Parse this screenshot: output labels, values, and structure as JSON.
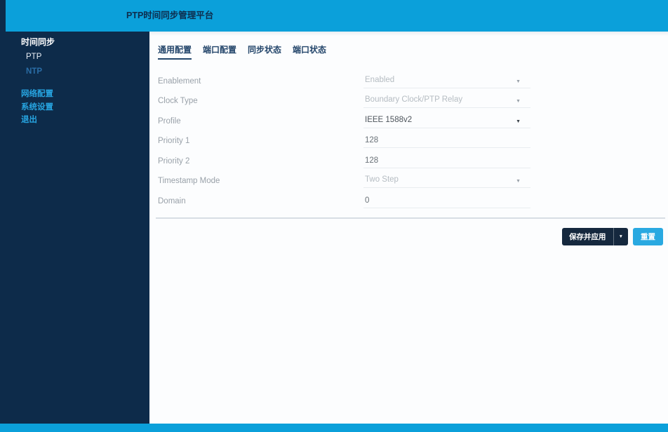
{
  "header": {
    "title": "PTP时间同步管理平台"
  },
  "sidebar": {
    "items": [
      {
        "label": "时间同步"
      },
      {
        "label": "PTP"
      },
      {
        "label": "NTP"
      },
      {
        "label": "网络配置"
      },
      {
        "label": "系统设置"
      },
      {
        "label": "退出"
      }
    ]
  },
  "main": {
    "tabs": [
      {
        "label": "通用配置",
        "active": true
      },
      {
        "label": "端口配置",
        "active": false
      },
      {
        "label": "同步状态",
        "active": false
      },
      {
        "label": "端口状态",
        "active": false
      }
    ],
    "form": {
      "fields": [
        {
          "label": "Enablement",
          "value": "Enabled",
          "type": "select",
          "disabled": true
        },
        {
          "label": "Clock Type",
          "value": "Boundary Clock/PTP Relay",
          "type": "select",
          "disabled": true
        },
        {
          "label": "Profile",
          "value": "IEEE 1588v2",
          "type": "select",
          "disabled": false
        },
        {
          "label": "Priority 1",
          "value": "128",
          "type": "input",
          "disabled": false
        },
        {
          "label": "Priority 2",
          "value": "128",
          "type": "input",
          "disabled": false
        },
        {
          "label": "Timestamp Mode",
          "value": "Two Step",
          "type": "select",
          "disabled": true
        },
        {
          "label": "Domain",
          "value": "0",
          "type": "input",
          "disabled": false
        }
      ],
      "caret_glyph": "▼"
    },
    "actions": {
      "save_label": "保存并应用",
      "save_caret": "▼",
      "reset_label": "重置"
    }
  },
  "colors": {
    "accent_cyan": "#0ba0da",
    "sidebar_navy": "#0d2b4a",
    "button_navy": "#15283e",
    "link_cyan": "#27a4e0"
  }
}
